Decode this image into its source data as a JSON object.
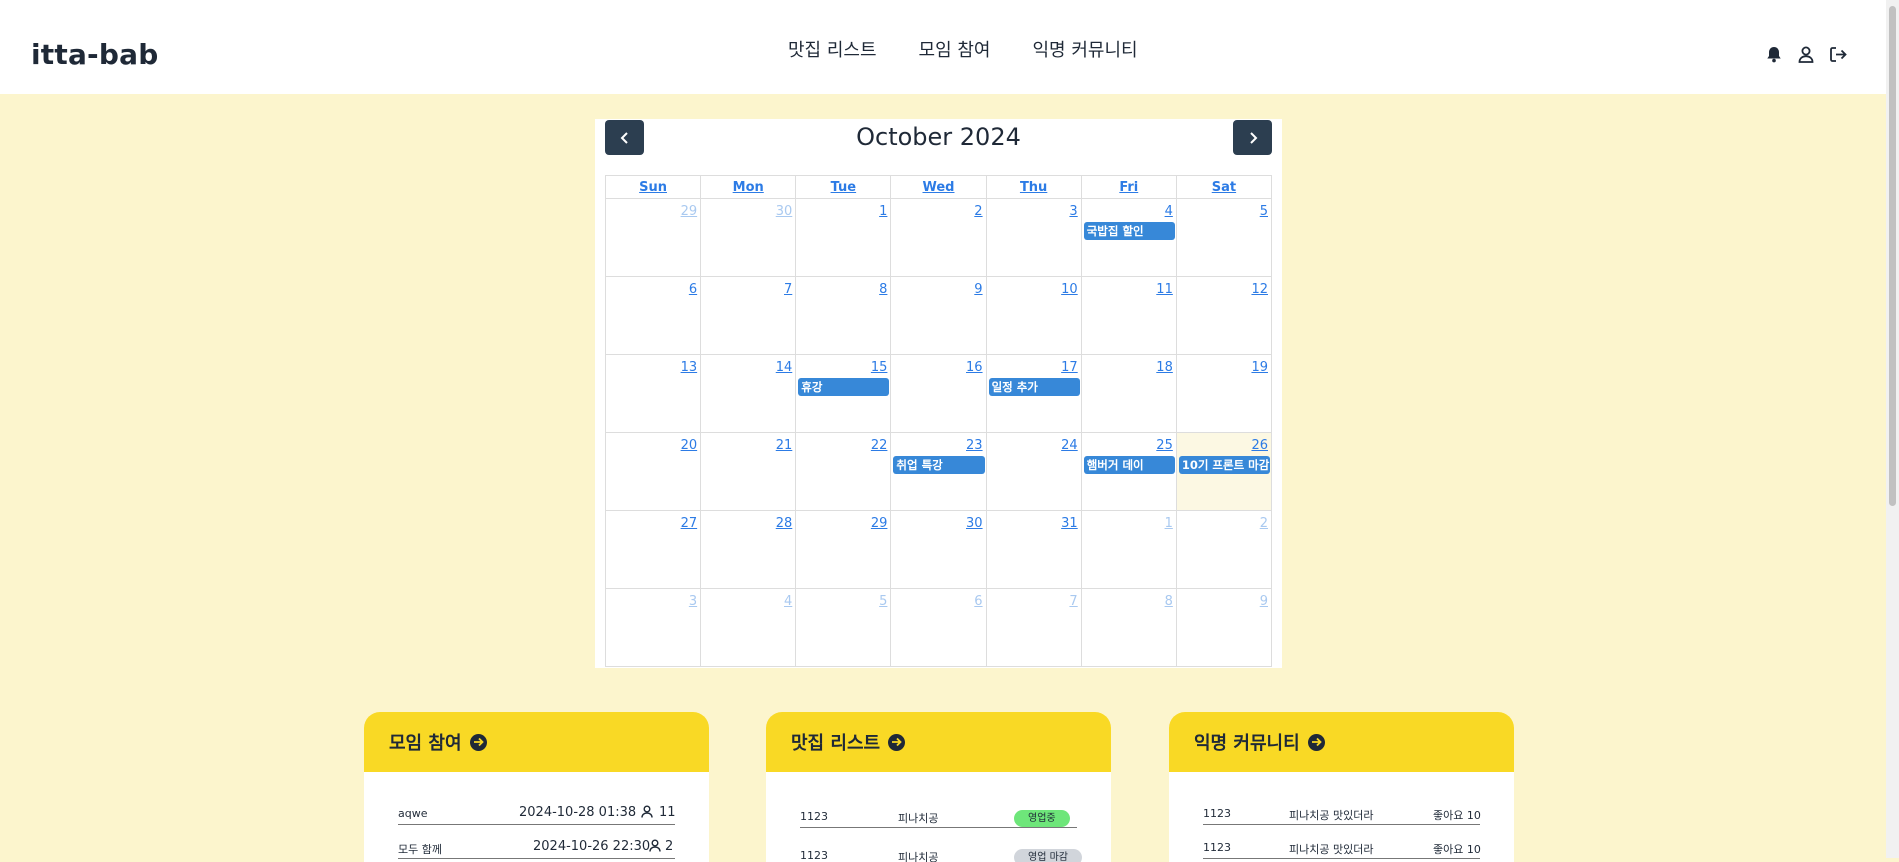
{
  "header": {
    "logo": "itta-bab",
    "nav": [
      "맛집 리스트",
      "모임 참여",
      "익명 커뮤니티"
    ],
    "icons": [
      "bell-icon",
      "user-icon",
      "logout-icon"
    ]
  },
  "calendar": {
    "title": "October 2024",
    "weekdays": [
      "Sun",
      "Mon",
      "Tue",
      "Wed",
      "Thu",
      "Fri",
      "Sat"
    ],
    "weeks": [
      [
        {
          "d": "29",
          "o": true
        },
        {
          "d": "30",
          "o": true
        },
        {
          "d": "1"
        },
        {
          "d": "2"
        },
        {
          "d": "3"
        },
        {
          "d": "4",
          "e": "국밥집 할인"
        },
        {
          "d": "5"
        }
      ],
      [
        {
          "d": "6"
        },
        {
          "d": "7"
        },
        {
          "d": "8"
        },
        {
          "d": "9"
        },
        {
          "d": "10"
        },
        {
          "d": "11"
        },
        {
          "d": "12"
        }
      ],
      [
        {
          "d": "13"
        },
        {
          "d": "14"
        },
        {
          "d": "15",
          "e": "휴강"
        },
        {
          "d": "16"
        },
        {
          "d": "17",
          "e": "일정 추가"
        },
        {
          "d": "18"
        },
        {
          "d": "19"
        }
      ],
      [
        {
          "d": "20"
        },
        {
          "d": "21"
        },
        {
          "d": "22"
        },
        {
          "d": "23",
          "e": "취업 특강"
        },
        {
          "d": "24"
        },
        {
          "d": "25",
          "e": "햄버거 데이"
        },
        {
          "d": "26",
          "e": "10기 프론트 마감",
          "today": true
        }
      ],
      [
        {
          "d": "27"
        },
        {
          "d": "28"
        },
        {
          "d": "29"
        },
        {
          "d": "30"
        },
        {
          "d": "31"
        },
        {
          "d": "1",
          "o": true
        },
        {
          "d": "2",
          "o": true
        }
      ],
      [
        {
          "d": "3",
          "o": true
        },
        {
          "d": "4",
          "o": true
        },
        {
          "d": "5",
          "o": true
        },
        {
          "d": "6",
          "o": true
        },
        {
          "d": "7",
          "o": true
        },
        {
          "d": "8",
          "o": true
        },
        {
          "d": "9",
          "o": true
        }
      ]
    ]
  },
  "cards": {
    "meetings": {
      "title": "모임 참여",
      "rows": [
        {
          "name": "aqwe",
          "date": "2024-10-28 01:38",
          "count": "11"
        },
        {
          "name": "모두 함께",
          "date": "2024-10-26 22:30",
          "count": "2"
        }
      ]
    },
    "restaurants": {
      "title": "맛집 리스트",
      "rows": [
        {
          "id": "1123",
          "name": "피나치공",
          "status": "영업중",
          "status_color": "#6ee67a"
        },
        {
          "id": "1123",
          "name": "피나치공",
          "status": "영업 마감",
          "status_color": "#d1d5db"
        }
      ]
    },
    "community": {
      "title": "익명 커뮤니티",
      "rows": [
        {
          "id": "1123",
          "title": "피나치공 맛있더라",
          "likes": "좋아요 10"
        },
        {
          "id": "1123",
          "title": "피나치공 맛있더라",
          "likes": "좋아요 10"
        }
      ]
    }
  }
}
